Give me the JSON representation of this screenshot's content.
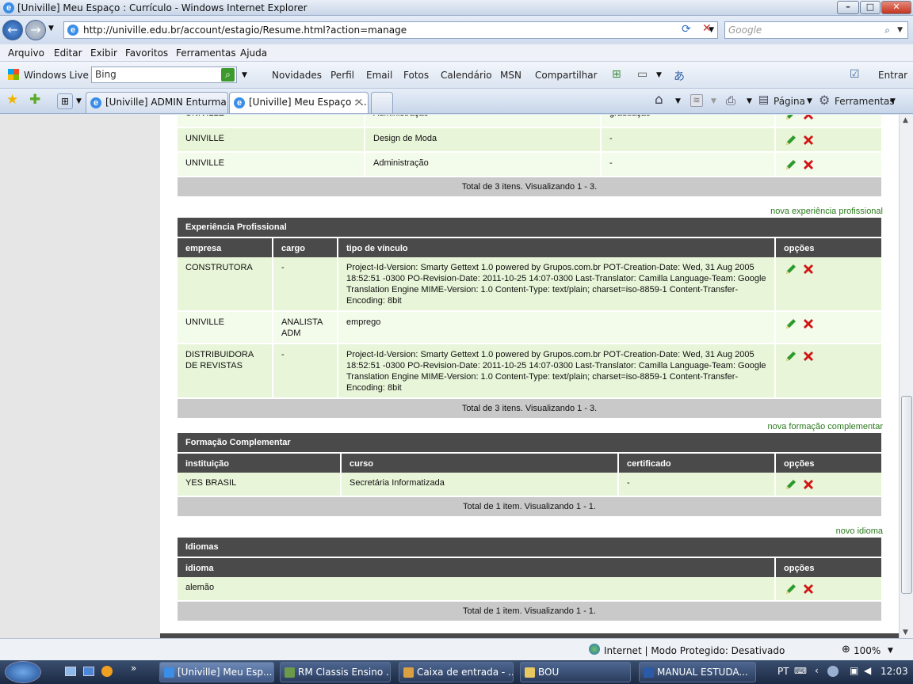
{
  "window": {
    "title": "[Univille] Meu Espaço : Currículo - Windows Internet Explorer"
  },
  "address": {
    "url": "http://univille.edu.br/account/estagio/Resume.html?action=manage",
    "search_placeholder": "Google"
  },
  "menu": [
    "Arquivo",
    "Editar",
    "Exibir",
    "Favoritos",
    "Ferramentas",
    "Ajuda"
  ],
  "live_toolbar": {
    "brand": "Windows Live",
    "search_value": "Bing",
    "links": [
      "Novidades",
      "Perfil",
      "Email",
      "Fotos",
      "Calendário",
      "MSN",
      "Compartilhar"
    ],
    "signin": "Entrar"
  },
  "tabs": [
    "[Univille] ADMIN Enturma ...",
    "[Univille] Meu Espaço : ..."
  ],
  "command_bar": {
    "page": "Página",
    "tools": "Ferramentas"
  },
  "graduacao": {
    "partial_row": [
      "UNIVILLE",
      "Administração",
      "graduação"
    ],
    "rows": [
      [
        "UNIVILLE",
        "Design de Moda",
        "-"
      ],
      [
        "UNIVILLE",
        "Administração",
        "-"
      ]
    ],
    "total": "Total de 3 itens. Visualizando 1 - 3."
  },
  "experiencia": {
    "add_link": "nova experiência profissional",
    "title": "Experiência Profissional",
    "columns": [
      "empresa",
      "cargo",
      "tipo de vínculo",
      "opções"
    ],
    "rows": [
      [
        "CONSTRUTORA",
        "-",
        "Project-Id-Version: Smarty Gettext 1.0 powered by Grupos.com.br POT-Creation-Date: Wed, 31 Aug 2005 18:52:51 -0300 PO-Revision-Date: 2011-10-25 14:07-0300 Last-Translator: Camilla Language-Team: Google Translation Engine MIME-Version: 1.0 Content-Type: text/plain; charset=iso-8859-1 Content-Transfer-Encoding: 8bit"
      ],
      [
        "UNIVILLE",
        "ANALISTA ADM",
        "emprego"
      ],
      [
        "DISTRIBUIDORA DE REVISTAS",
        "-",
        "Project-Id-Version: Smarty Gettext 1.0 powered by Grupos.com.br POT-Creation-Date: Wed, 31 Aug 2005 18:52:51 -0300 PO-Revision-Date: 2011-10-25 14:07-0300 Last-Translator: Camilla Language-Team: Google Translation Engine MIME-Version: 1.0 Content-Type: text/plain; charset=iso-8859-1 Content-Transfer-Encoding: 8bit"
      ]
    ],
    "total": "Total de 3 itens. Visualizando 1 - 3."
  },
  "formacao": {
    "add_link": "nova formação complementar",
    "title": "Formação Complementar",
    "columns": [
      "instituição",
      "curso",
      "certificado",
      "opções"
    ],
    "rows": [
      [
        "YES BRASIL",
        "Secretária Informatizada",
        "-"
      ]
    ],
    "total": "Total de 1 item. Visualizando 1 - 1."
  },
  "idiomas": {
    "add_link": "novo idioma",
    "title": "Idiomas",
    "columns": [
      "idioma",
      "opções"
    ],
    "rows": [
      [
        "alemão"
      ]
    ],
    "total": "Total de 1 item. Visualizando 1 - 1."
  },
  "status": {
    "zone": "Internet | Modo Protegido: Desativado",
    "zoom": "100%"
  },
  "taskbar": {
    "items": [
      "[Univille] Meu Esp...",
      "RM Classis Ensino ...",
      "Caixa de entrada - ...",
      "BOU",
      "MANUAL ESTUDA..."
    ],
    "lang": "PT",
    "clock": "12:03"
  },
  "colors": {
    "header_bg": "#4a4a4a",
    "row_odd": "#e8f5d8",
    "row_even": "#f3fbea",
    "footer_bg": "#c9c9c9",
    "link": "#2a7a1c",
    "edit_icon": "#2e9a2e",
    "delete_icon": "#d11414"
  }
}
